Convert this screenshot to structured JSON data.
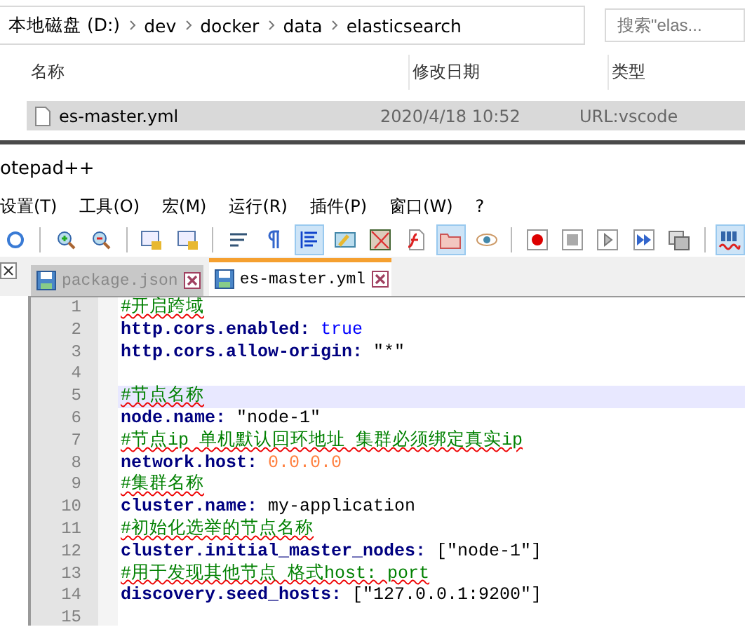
{
  "explorer": {
    "breadcrumbs": [
      "本地磁盘 (D:)",
      "dev",
      "docker",
      "data",
      "elasticsearch"
    ],
    "search": {
      "placeholder": "搜索\"elas..."
    },
    "columns": [
      "名称",
      "修改日期",
      "类型"
    ],
    "files": [
      {
        "name": "es-master.yml",
        "modified": "2020/4/18 10:52",
        "type": "URL:vscode",
        "selected": true
      }
    ]
  },
  "editor": {
    "title": "otepad++",
    "menu": [
      "设置(T)",
      "工具(O)",
      "宏(M)",
      "运行(R)",
      "插件(P)",
      "窗口(W)",
      "?"
    ],
    "toolbar": [
      {
        "kind": "sync",
        "selected": false
      },
      {
        "kind": "sep"
      },
      {
        "kind": "zoom-in",
        "selected": false
      },
      {
        "kind": "zoom-out",
        "selected": false
      },
      {
        "kind": "sep"
      },
      {
        "kind": "lock",
        "selected": false
      },
      {
        "kind": "lock",
        "selected": false
      },
      {
        "kind": "sep"
      },
      {
        "kind": "wrap",
        "selected": false
      },
      {
        "kind": "pilcrow",
        "selected": false
      },
      {
        "kind": "indent",
        "selected": true
      },
      {
        "kind": "lang",
        "selected": false
      },
      {
        "kind": "map",
        "selected": false
      },
      {
        "kind": "func",
        "selected": false
      },
      {
        "kind": "folder",
        "selected": true
      },
      {
        "kind": "eye",
        "selected": false
      },
      {
        "kind": "sep"
      },
      {
        "kind": "record",
        "selected": false
      },
      {
        "kind": "stop",
        "selected": false
      },
      {
        "kind": "play",
        "selected": false
      },
      {
        "kind": "play-multi",
        "selected": false
      },
      {
        "kind": "save-macro",
        "selected": false
      },
      {
        "kind": "sep"
      },
      {
        "kind": "spell",
        "selected": true
      }
    ],
    "tabs": [
      {
        "label": "package.json",
        "selected": false
      },
      {
        "label": "es-master.yml",
        "selected": true
      }
    ],
    "lines": [
      {
        "number": "1",
        "current": false,
        "tokens": [
          {
            "kind": "comment",
            "text": "#开启跨域"
          }
        ]
      },
      {
        "number": "2",
        "current": false,
        "tokens": [
          {
            "kind": "key",
            "text": "http.cors.enabled:"
          },
          {
            "kind": "keyword",
            "text": " true"
          }
        ]
      },
      {
        "number": "3",
        "current": false,
        "tokens": [
          {
            "kind": "key",
            "text": "http.cors.allow-origin:"
          },
          {
            "kind": "string",
            "text": " \"*\""
          }
        ]
      },
      {
        "number": "4",
        "current": false
      },
      {
        "number": "5",
        "current": true,
        "tokens": [
          {
            "kind": "comment",
            "text": "#节点名称"
          }
        ]
      },
      {
        "number": "6",
        "current": false,
        "tokens": [
          {
            "kind": "key",
            "text": "node.name:"
          },
          {
            "kind": "string",
            "text": " \"node-1\""
          }
        ]
      },
      {
        "number": "7",
        "current": false,
        "tokens": [
          {
            "kind": "comment",
            "text": "#节点ip 单机默认回环地址 集群必须绑定真实ip"
          }
        ]
      },
      {
        "number": "8",
        "current": false,
        "tokens": [
          {
            "kind": "key",
            "text": "network.host:"
          },
          {
            "kind": "number",
            "text": " 0.0.0.0"
          }
        ]
      },
      {
        "number": "9",
        "current": false,
        "tokens": [
          {
            "kind": "comment",
            "text": "#集群名称"
          }
        ]
      },
      {
        "number": "10",
        "current": false,
        "tokens": [
          {
            "kind": "key",
            "text": "cluster.name:"
          },
          {
            "kind": "string",
            "text": " my-application"
          }
        ]
      },
      {
        "number": "11",
        "current": false,
        "tokens": [
          {
            "kind": "comment",
            "text": "#初始化选举的节点名称"
          }
        ]
      },
      {
        "number": "12",
        "current": false,
        "tokens": [
          {
            "kind": "key",
            "text": "cluster.initial_master_nodes:"
          },
          {
            "kind": "string",
            "text": " [\"node-1\"]"
          }
        ]
      },
      {
        "number": "13",
        "current": false,
        "tokens": [
          {
            "kind": "comment",
            "text": "#用于发现其他节点 格式host: port"
          }
        ]
      },
      {
        "number": "14",
        "current": false,
        "tokens": [
          {
            "kind": "key",
            "text": "discovery.seed_hosts:"
          },
          {
            "kind": "string",
            "text": " [\"127.0.0.1:9200\"]"
          }
        ]
      },
      {
        "number": "15",
        "current": false
      }
    ]
  }
}
